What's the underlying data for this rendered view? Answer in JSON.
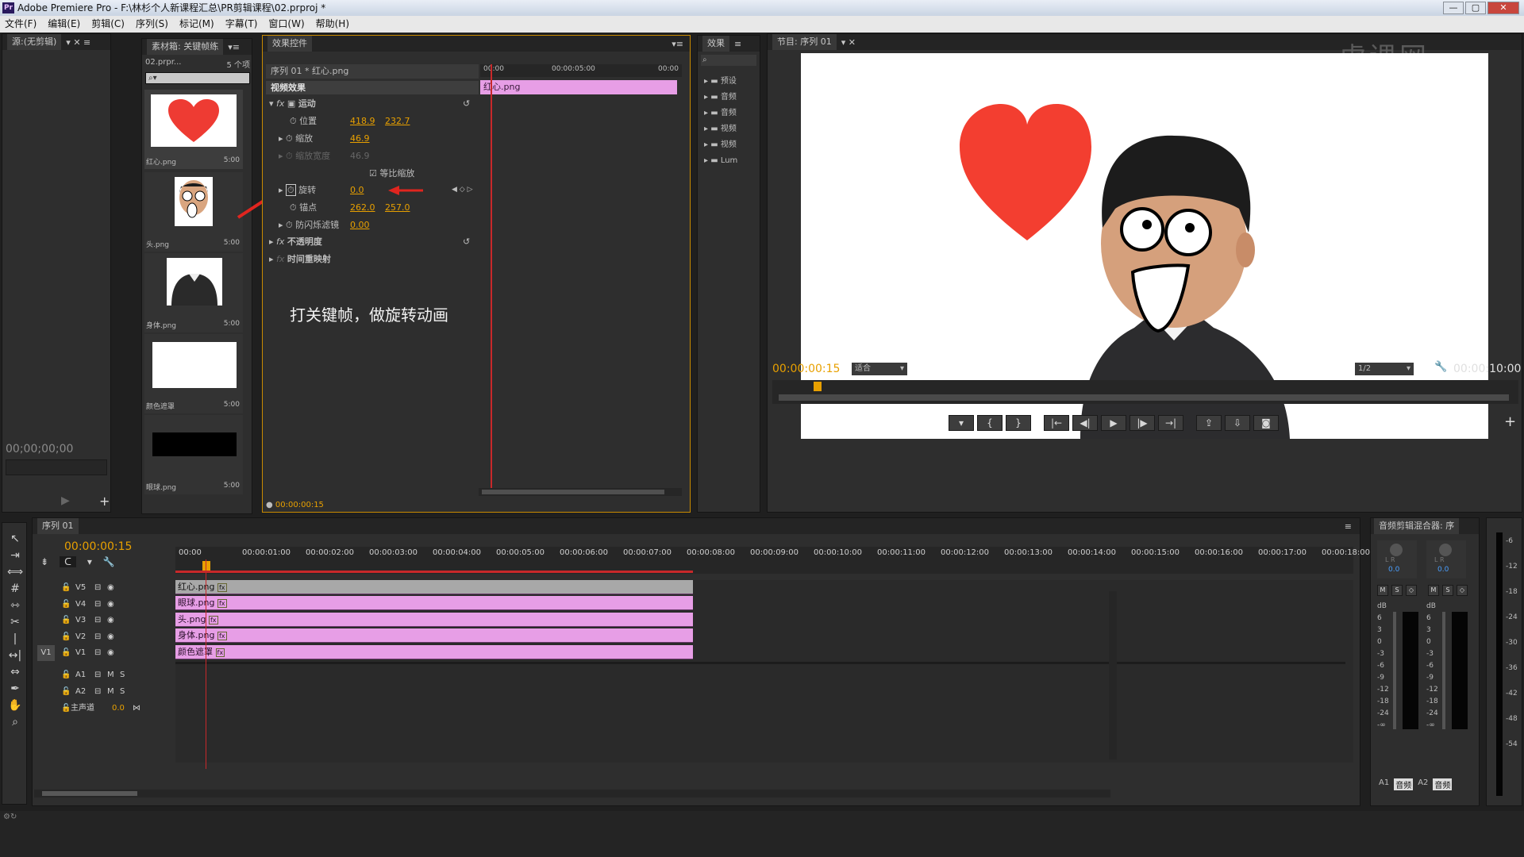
{
  "window": {
    "title": "Adobe Premiere Pro - F:\\林杉个人新课程汇总\\PR剪辑课程\\02.prproj *",
    "app_icon": "Pr",
    "buttons": [
      "—",
      "▢",
      "✕"
    ]
  },
  "menu": [
    "文件(F)",
    "编辑(E)",
    "剪辑(C)",
    "序列(S)",
    "标记(M)",
    "字幕(T)",
    "窗口(W)",
    "帮助(H)"
  ],
  "source": {
    "tab": "源:(无剪辑)",
    "timecode": "00;00;00;00"
  },
  "bin": {
    "tab": "素材箱: 关键帧练",
    "project": "02.prpr...",
    "count": "5 个项",
    "search_placeholder": "",
    "items": [
      {
        "name": "红心.png",
        "duration": "5:00"
      },
      {
        "name": "头.png",
        "duration": "5:00"
      },
      {
        "name": "身体.png",
        "duration": "5:00"
      },
      {
        "name": "颜色遮罩",
        "duration": "5:00"
      },
      {
        "name": "眼球.png",
        "duration": "5:00"
      }
    ]
  },
  "effect_controls": {
    "tab": "效果控件",
    "sequence_clip": "序列 01 * 红心.png",
    "mini_ruler": [
      "00:00",
      "00:00:05:00",
      "00:00"
    ],
    "mini_clip": "红心.png",
    "section": "视频效果",
    "motion": "运动",
    "properties": [
      {
        "name": "位置",
        "v1": "418.9",
        "v2": "232.7"
      },
      {
        "name": "缩放",
        "v1": "46.9",
        "v2": ""
      },
      {
        "name": "缩放宽度",
        "v1": "46.9",
        "v2": ""
      },
      {
        "name": "旋转",
        "v1": "0.0",
        "v2": ""
      },
      {
        "name": "锚点",
        "v1": "262.0",
        "v2": "257.0"
      },
      {
        "name": "防闪烁滤镜",
        "v1": "0.00",
        "v2": ""
      }
    ],
    "uniform_scale": "等比缩放",
    "opacity": "不透明度",
    "time_remap": "时间重映射",
    "annotation": "打关键帧，做旋转动画",
    "timecode": "00:00:00:15"
  },
  "effects_panel": {
    "tab": "效果",
    "folders": [
      "预设",
      "音频",
      "音频",
      "视频",
      "视频",
      "Lum"
    ]
  },
  "program": {
    "tab": "节目: 序列 01",
    "timecode": "00:00:00:15",
    "fit": "适合",
    "resolution": "1/2",
    "duration": "00:00:10:00",
    "watermark": "虎课网"
  },
  "timeline": {
    "tab": "序列 01",
    "timecode": "00:00:00:15",
    "ruler": [
      "00:00",
      "00:00:01:00",
      "00:00:02:00",
      "00:00:03:00",
      "00:00:04:00",
      "00:00:05:00",
      "00:00:06:00",
      "00:00:07:00",
      "00:00:08:00",
      "00:00:09:00",
      "00:00:10:00",
      "00:00:11:00",
      "00:00:12:00",
      "00:00:13:00",
      "00:00:14:00",
      "00:00:15:00",
      "00:00:16:00",
      "00:00:17:00",
      "00:00:18:00"
    ],
    "video_tracks": [
      {
        "name": "V5",
        "clip": "红心.png"
      },
      {
        "name": "V4",
        "clip": "眼球.png"
      },
      {
        "name": "V3",
        "clip": "头.png"
      },
      {
        "name": "V2",
        "clip": "身体.png"
      },
      {
        "name": "V1",
        "clip": "颜色遮罩"
      }
    ],
    "source_patch": "V1",
    "audio_tracks": [
      "A1",
      "A2"
    ],
    "master": {
      "name": "主声道",
      "value": "0.0"
    }
  },
  "mixer": {
    "tab": "音频剪辑混合器: 序",
    "values": [
      "0.0",
      "0.0"
    ],
    "db_scale": [
      "dB",
      "6",
      "3",
      "0",
      "-3",
      "-6",
      "-9",
      "-12",
      "-18",
      "-24",
      "-∞"
    ],
    "right_scale": [
      "-6",
      "-12",
      "-18",
      "-24",
      "-30",
      "-36",
      "-42",
      "-48",
      "-54"
    ],
    "channels": [
      "A1",
      "A2"
    ],
    "button": "音频",
    "msk": [
      "M",
      "S",
      "◇"
    ],
    "lr": "L  R"
  },
  "colors": {
    "accent": "#e8a000",
    "clip_pink": "#e79ee6",
    "clip_gray": "#a8a8a8",
    "playhead": "#c8282a"
  }
}
